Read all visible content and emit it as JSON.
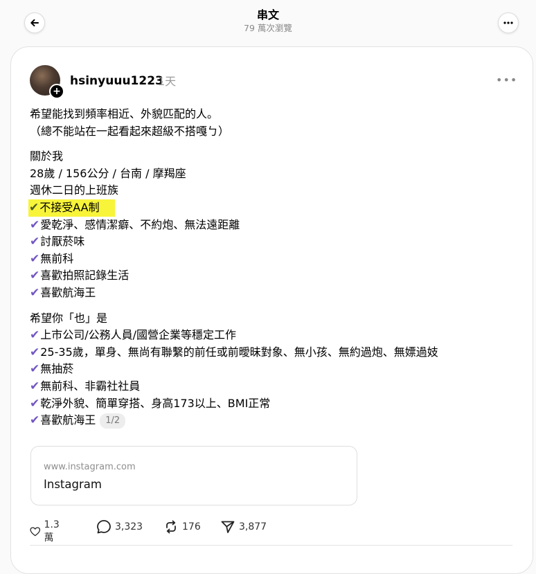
{
  "header": {
    "title": "串文",
    "subtitle": "79 萬次瀏覽"
  },
  "post": {
    "username": "hsinyuuu1223",
    "time": "1天",
    "lines": [
      "希望能找到頻率相近、外貌匹配的人。",
      "（總不能站在一起看起來超級不搭嘎ㄅ）",
      "關於我",
      "28歲 / 156公分 / 台南 / 摩羯座",
      "週休二日的上班族",
      "不接受AA制",
      "愛乾淨、感情潔癖、不約炮、無法遠距離",
      "討厭菸味",
      "無前科",
      "喜歡拍照記錄生活",
      "喜歡航海王",
      "希望你「也」是",
      "上市公司/公務人員/國營企業等穩定工作",
      "25-35歲，單身、無尚有聯繫的前任或前曖昧對象、無小孩、無約過炮、無嫖過妓",
      "無抽菸",
      "無前科、非霸社社員",
      "乾淨外貌、簡單穿搭、身高173以上、BMI正常",
      "喜歡航海王"
    ],
    "page_indicator": "1/2",
    "check_color": "#7356c2",
    "highlight_color": "#f8f43a"
  },
  "link_preview": {
    "url": "www.instagram.com",
    "title": "Instagram"
  },
  "actions": {
    "likes": "1.3 萬",
    "replies": "3,323",
    "reposts": "176",
    "shares": "3,877"
  },
  "icons": {
    "back": "arrow-left-icon",
    "more": "more-dots-icon",
    "check": "checkmark-icon",
    "like": "heart-icon",
    "reply": "comment-icon",
    "repost": "repost-icon",
    "share": "send-icon"
  }
}
